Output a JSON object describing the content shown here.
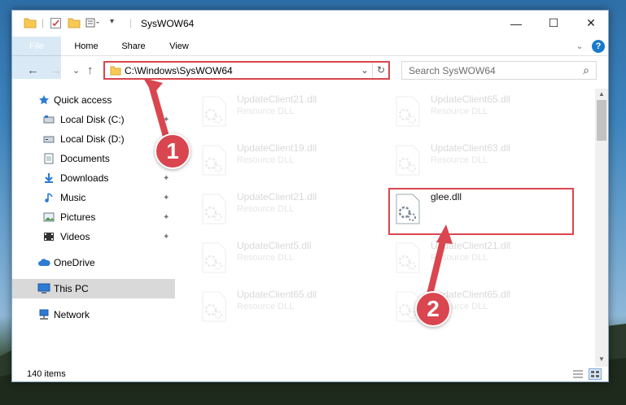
{
  "window": {
    "title": "SysWOW64",
    "controls": {
      "minimize": "—",
      "maximize": "☐",
      "close": "✕"
    }
  },
  "ribbon": {
    "tabs": [
      "File",
      "Home",
      "Share",
      "View"
    ],
    "expand_glyph": "⌄",
    "help_glyph": "?"
  },
  "address": {
    "path": "C:\\Windows\\SysWOW64",
    "refresh_glyph": "↻",
    "dropdown_glyph": "⌄"
  },
  "search": {
    "placeholder": "Search SysWOW64",
    "icon_glyph": "⌕"
  },
  "nav_buttons": {
    "back": "←",
    "forward": "→",
    "recent": "⌄",
    "up": "↑"
  },
  "nav_pane": {
    "items": [
      {
        "label": "Quick access",
        "icon": "star-icon",
        "pinned": false
      },
      {
        "label": "Local Disk (C:)",
        "icon": "drive-icon",
        "pinned": true
      },
      {
        "label": "Local Disk (D:)",
        "icon": "drive-icon",
        "pinned": false
      },
      {
        "label": "Documents",
        "icon": "documents-icon",
        "pinned": true
      },
      {
        "label": "Downloads",
        "icon": "downloads-icon",
        "pinned": true
      },
      {
        "label": "Music",
        "icon": "music-icon",
        "pinned": true
      },
      {
        "label": "Pictures",
        "icon": "pictures-icon",
        "pinned": true
      },
      {
        "label": "Videos",
        "icon": "videos-icon",
        "pinned": true
      },
      {
        "label": "OneDrive",
        "icon": "onedrive-icon",
        "pinned": false
      },
      {
        "label": "This PC",
        "icon": "this-pc-icon",
        "pinned": false,
        "selected": true
      },
      {
        "label": "Network",
        "icon": "network-icon",
        "pinned": false
      }
    ],
    "pin_glyph": "📌"
  },
  "files": [
    {
      "name": "UpdateClient21.dll",
      "type": "Resource DLL",
      "faded": true
    },
    {
      "name": "UpdateClient65.dll",
      "type": "Resource DLL",
      "faded": true
    },
    {
      "name": "UpdateClient19.dll",
      "type": "Resource DLL",
      "faded": true
    },
    {
      "name": "UpdateClient63.dll",
      "type": "Resource DLL",
      "faded": true
    },
    {
      "name": "UpdateClient21.dll",
      "type": "Resource DLL",
      "faded": true
    },
    {
      "name": "glee.dll",
      "type": "",
      "faded": false
    },
    {
      "name": "UpdateClient5.dll",
      "type": "Resource DLL",
      "faded": true
    },
    {
      "name": "UpdateClient21.dll",
      "type": "Resource DLL",
      "faded": true
    },
    {
      "name": "UpdateClient65.dll",
      "type": "Resource DLL",
      "faded": true
    },
    {
      "name": "UpdateClient65.dll",
      "type": "Resource DLL",
      "faded": true
    }
  ],
  "status": {
    "item_count": "140 items"
  },
  "annotations": {
    "step1": "1",
    "step2": "2"
  },
  "colors": {
    "accent": "#1979ca",
    "highlight": "#d9464f"
  }
}
